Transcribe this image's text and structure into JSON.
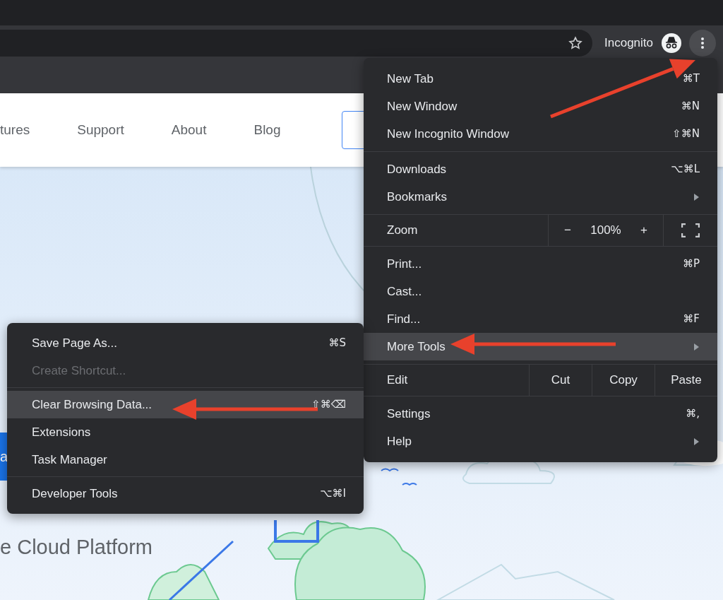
{
  "toolbar": {
    "profile_label": "Incognito"
  },
  "site_nav": [
    "tures",
    "Support",
    "About",
    "Blog"
  ],
  "page": {
    "cta": "a",
    "platform": "e Cloud Platform"
  },
  "main_menu": {
    "groups": [
      {
        "items": [
          {
            "kind": "item",
            "label": "New Tab",
            "shortcut": "⌘T",
            "submenu": false,
            "selected": false
          },
          {
            "kind": "item",
            "label": "New Window",
            "shortcut": "⌘N",
            "submenu": false,
            "selected": false
          },
          {
            "kind": "item",
            "label": "New Incognito Window",
            "shortcut": "⇧⌘N",
            "submenu": false,
            "selected": false
          }
        ]
      },
      {
        "items": [
          {
            "kind": "item",
            "label": "Downloads",
            "shortcut": "⌥⌘L",
            "submenu": false,
            "selected": false
          },
          {
            "kind": "item",
            "label": "Bookmarks",
            "submenu": true,
            "selected": false
          }
        ]
      },
      {
        "items": [
          {
            "kind": "zoom",
            "label": "Zoom",
            "minus": "−",
            "value": "100%",
            "plus": "+"
          }
        ]
      },
      {
        "items": [
          {
            "kind": "item",
            "label": "Print...",
            "shortcut": "⌘P",
            "submenu": false,
            "selected": false
          },
          {
            "kind": "item",
            "label": "Cast...",
            "submenu": false,
            "selected": false
          },
          {
            "kind": "item",
            "label": "Find...",
            "shortcut": "⌘F",
            "submenu": false,
            "selected": false
          },
          {
            "kind": "item",
            "label": "More Tools",
            "submenu": true,
            "selected": true
          }
        ]
      },
      {
        "items": [
          {
            "kind": "edit",
            "label": "Edit",
            "actions": [
              "Cut",
              "Copy",
              "Paste"
            ]
          }
        ]
      },
      {
        "items": [
          {
            "kind": "item",
            "label": "Settings",
            "shortcut": "⌘,",
            "submenu": false,
            "selected": false
          },
          {
            "kind": "item",
            "label": "Help",
            "submenu": true,
            "selected": false
          }
        ]
      }
    ]
  },
  "sub_menu": {
    "groups": [
      {
        "items": [
          {
            "label": "Save Page As...",
            "shortcut": "⌘S",
            "disabled": false,
            "selected": false
          },
          {
            "label": "Create Shortcut...",
            "disabled": true,
            "selected": false
          }
        ]
      },
      {
        "items": [
          {
            "label": "Clear Browsing Data...",
            "shortcut": "⇧⌘⌫",
            "disabled": false,
            "selected": true
          },
          {
            "label": "Extensions",
            "disabled": false,
            "selected": false
          },
          {
            "label": "Task Manager",
            "disabled": false,
            "selected": false
          }
        ]
      },
      {
        "items": [
          {
            "label": "Developer Tools",
            "shortcut": "⌥⌘I",
            "disabled": false,
            "selected": false
          }
        ]
      }
    ]
  }
}
